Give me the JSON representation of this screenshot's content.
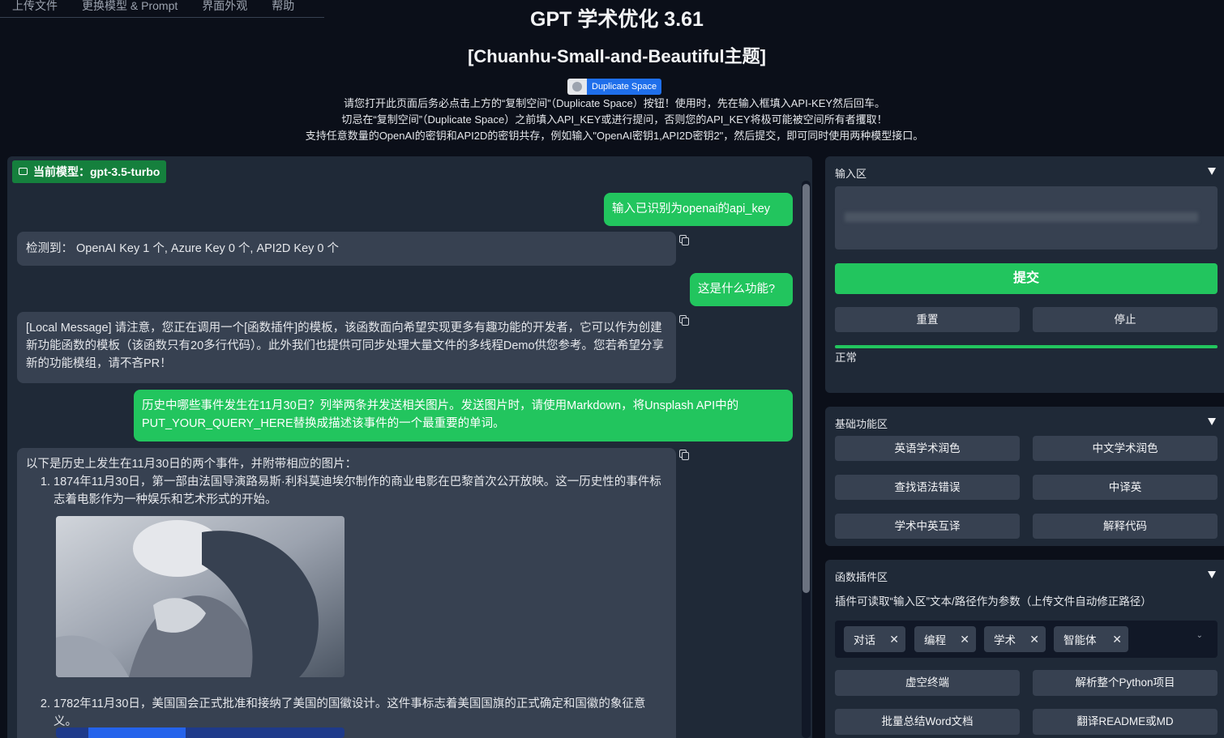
{
  "nav": {
    "tabs": [
      "上传文件",
      "更换模型 & Prompt",
      "界面外观",
      "帮助"
    ]
  },
  "header": {
    "title": "GPT 学术优化 3.61",
    "subtitle": "[Chuanhu-Small-and-Beautiful主题]",
    "duplicate_label": "Duplicate Space",
    "notice_lines": [
      "请您打开此页面后务必点击上方的“复制空间”（Duplicate Space）按钮！使用时，先在输入框填入API-KEY然后回车。",
      "切忌在“复制空间”（Duplicate Space）之前填入API_KEY或进行提问，否则您的API_KEY将极可能被空间所有者攫取！",
      "支持任意数量的OpenAI的密钥和API2D的密钥共存，例如输入\"OpenAI密钥1,API2D密钥2\"，然后提交，即可同时使用两种模型接口。"
    ]
  },
  "chat": {
    "model_badge": "当前模型：gpt-3.5-turbo",
    "messages": [
      {
        "role": "user",
        "text": "输入已识别为openai的api_key"
      },
      {
        "role": "bot",
        "text": "检测到： OpenAI Key 1 个, Azure Key 0 个, API2D Key 0 个"
      },
      {
        "role": "user",
        "text": "这是什么功能?"
      },
      {
        "role": "bot",
        "text": "[Local Message] 请注意，您正在调用一个[函数插件]的模板，该函数面向希望实现更多有趣功能的开发者，它可以作为创建新功能函数的模板（该函数只有20多行代码）。此外我们也提供可同步处理大量文件的多线程Demo供您参考。您若希望分享新的功能模组，请不吝PR！"
      },
      {
        "role": "user",
        "text": "历史中哪些事件发生在11月30日？列举两条并发送相关图片。发送图片时，请使用Markdown，将Unsplash API中的PUT_YOUR_QUERY_HERE替换成描述该事件的一个最重要的单词。"
      },
      {
        "role": "bot",
        "intro": "以下是历史上发生在11月30日的两个事件，并附带相应的图片：",
        "items": [
          {
            "num": "1.",
            "text": "1874年11月30日，第一部由法国导演路易斯·利科莫迪埃尔制作的商业电影在巴黎首次公开放映。这一历史性的事件标志着电影作为一种娱乐和艺术形式的开始。"
          },
          {
            "num": "2.",
            "text": "1782年11月30日，美国国会正式批准和接纳了美国的国徽设计。这件事标志着美国国旗的正式确定和国徽的象征意义。"
          }
        ]
      }
    ]
  },
  "input_panel": {
    "title": "输入区",
    "submit": "提交",
    "reset": "重置",
    "stop": "停止",
    "status": "正常",
    "progress": 1.0
  },
  "basic_panel": {
    "title": "基础功能区",
    "buttons": [
      "英语学术润色",
      "中文学术润色",
      "查找语法错误",
      "中译英",
      "学术中英互译",
      "解释代码"
    ]
  },
  "plugin_panel": {
    "title": "函数插件区",
    "hint": "插件可读取“输入区”文本/路径作为参数（上传文件自动修正路径）",
    "tags": [
      "对话",
      "编程",
      "学术",
      "智能体"
    ],
    "buttons": [
      "虚空终端",
      "解析整个Python项目",
      "批量总结Word文档",
      "翻译README或MD"
    ]
  },
  "colors": {
    "accent": "#22c55e",
    "panel": "#1f2937",
    "background": "#0b0f19",
    "button": "#374151"
  }
}
